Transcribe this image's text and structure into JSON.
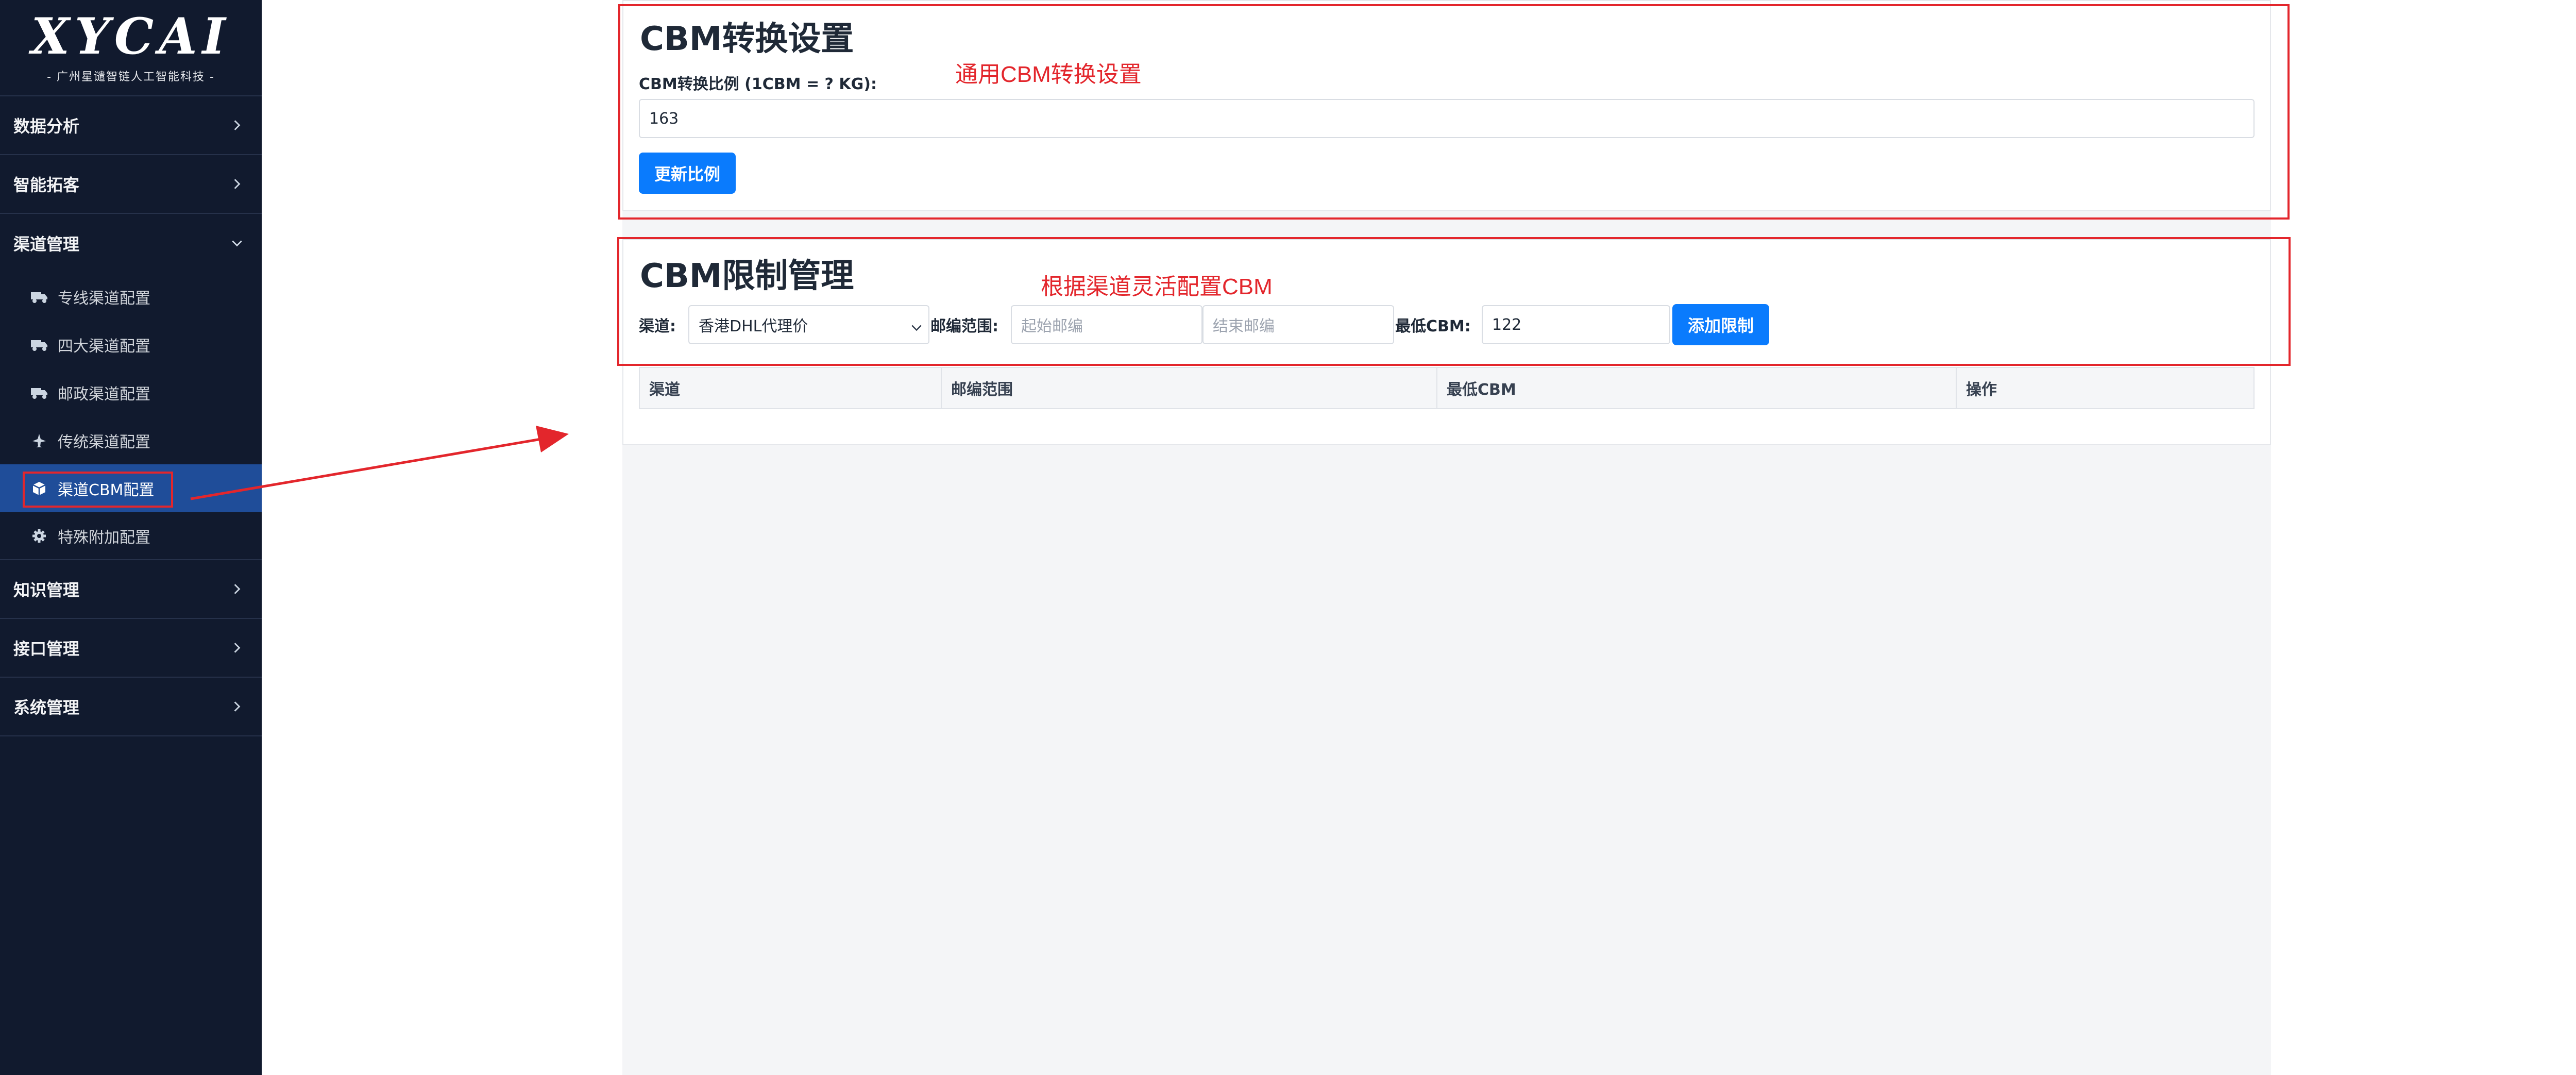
{
  "sidebar": {
    "logo": "XYCAI",
    "logo_sub": "- 广州星谴智链人工智能科技 -",
    "groups": [
      {
        "label": "数据分析",
        "icon": "chevron-right-icon"
      },
      {
        "label": "智能拓客",
        "icon": "chevron-right-icon"
      },
      {
        "label": "渠道管理",
        "icon": "chevron-down-icon"
      },
      {
        "label": "知识管理",
        "icon": "chevron-right-icon"
      },
      {
        "label": "接口管理",
        "icon": "chevron-right-icon"
      },
      {
        "label": "系统管理",
        "icon": "chevron-right-icon"
      }
    ],
    "channel_items": [
      {
        "label": "专线渠道配置",
        "icon": "truck-icon"
      },
      {
        "label": "四大渠道配置",
        "icon": "truck-icon"
      },
      {
        "label": "邮政渠道配置",
        "icon": "truck-icon"
      },
      {
        "label": "传统渠道配置",
        "icon": "plane-icon"
      },
      {
        "label": "渠道CBM配置",
        "icon": "cube-icon",
        "active": true
      },
      {
        "label": "特殊附加配置",
        "icon": "gear-icon"
      }
    ]
  },
  "cbm_settings": {
    "title": "CBM转换设置",
    "ratio_label": "CBM转换比例 (1CBM = ? KG):",
    "ratio_value": "163",
    "update_button": "更新比例",
    "annotation": "通用CBM转换设置"
  },
  "cbm_limits": {
    "title": "CBM限制管理",
    "annotation": "根据渠道灵活配置CBM",
    "channel_label": "渠道:",
    "channel_value": "香港DHL代理价",
    "zip_label": "邮编范围:",
    "zip_start_placeholder": "起始邮编",
    "zip_end_placeholder": "结束邮编",
    "min_cbm_label": "最低CBM:",
    "min_cbm_value": "122",
    "add_button": "添加限制",
    "table_headers": [
      "渠道",
      "邮编范围",
      "最低CBM",
      "操作"
    ]
  },
  "colors": {
    "sidebar_bg": "#111a2e",
    "active_item": "#1f4d99",
    "primary_button": "#0a7bfd",
    "annotation_red": "#e3262c"
  }
}
